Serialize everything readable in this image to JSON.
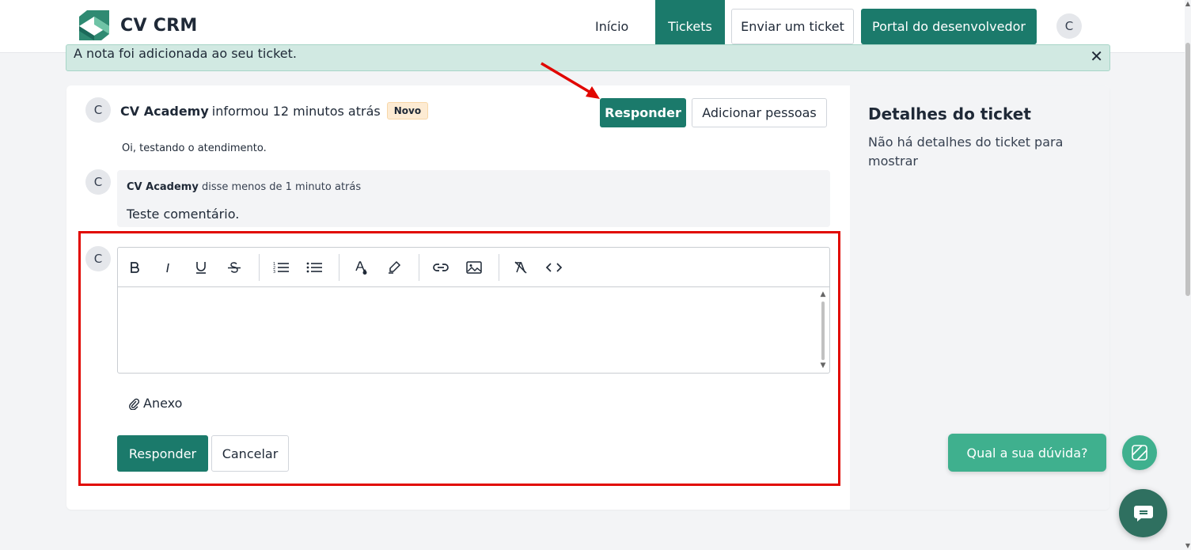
{
  "brand": {
    "name": "CV CRM"
  },
  "nav": {
    "inicio": "Início",
    "tickets": "Tickets",
    "submit_ticket": "Enviar um ticket",
    "dev_portal": "Portal do desenvolvedor",
    "avatar_initial": "C"
  },
  "alert": {
    "text": "A nota foi adicionada ao seu ticket.",
    "close": "✕"
  },
  "ticket": {
    "avatar_initial": "C",
    "author": "CV Academy",
    "reported": "informou 12 minutos atrás",
    "status_badge": "Novo",
    "reply_button": "Responder",
    "add_people_button": "Adicionar pessoas",
    "message": "Oi, testando o atendimento."
  },
  "comment": {
    "avatar_initial": "C",
    "author": "CV Academy",
    "said": "disse menos de 1 minuto atrás",
    "body": "Teste comentário."
  },
  "reply_form": {
    "avatar_initial": "C",
    "editor_value": "",
    "toolbar_icons": [
      "bold-icon",
      "italic-icon",
      "underline-icon",
      "strikethrough-icon",
      "ordered-list-icon",
      "bullet-list-icon",
      "text-color-icon",
      "highlight-icon",
      "link-icon",
      "image-icon",
      "clear-format-icon",
      "code-icon"
    ],
    "attachment_label": "Anexo",
    "submit_button": "Responder",
    "cancel_button": "Cancelar"
  },
  "sidebar": {
    "title": "Detalhes do ticket",
    "empty_text": "Não há detalhes do ticket para mostrar"
  },
  "help_widget": {
    "label": "Qual a sua dúvida?"
  },
  "colors": {
    "brand": "#1b7a6b",
    "help_green": "#3fb08e",
    "highlight_red": "#e10600",
    "alert_bg": "#d1e9e2",
    "badge_bg": "#fdebd3"
  }
}
